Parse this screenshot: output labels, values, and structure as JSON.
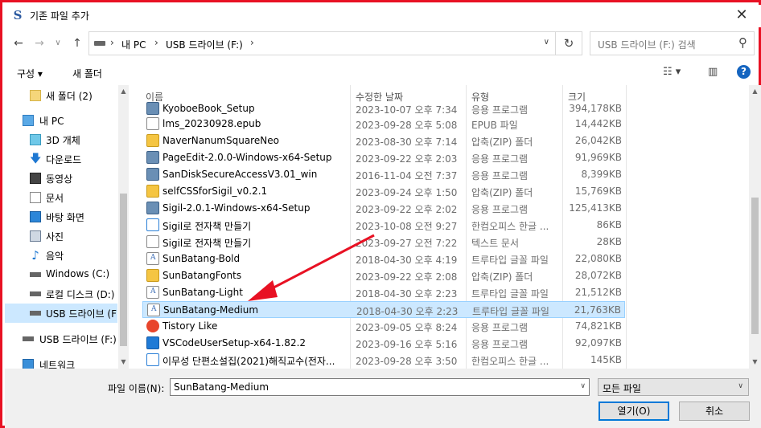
{
  "window": {
    "title": "기존 파일 추가",
    "app_icon_glyph": "S",
    "close_glyph": "✕"
  },
  "nav": {
    "back_glyph": "←",
    "forward_glyph": "→",
    "recent_glyph": "∨",
    "up_glyph": "↑",
    "address": {
      "crumbs": [
        "내 PC",
        "USB 드라이브 (F:)"
      ],
      "sep": "›",
      "dropdown_glyph": "∨",
      "refresh_glyph": "↻"
    },
    "search": {
      "placeholder": "USB 드라이브 (F:) 검색",
      "icon_glyph": "⚲"
    }
  },
  "toolbar": {
    "organize_label": "구성 ▾",
    "new_folder_label": "새 폴더",
    "view_glyph": "☷ ▾",
    "pane_glyph": "▥",
    "help_glyph": "?"
  },
  "sidebar": {
    "items": [
      {
        "label": "새 폴더 (2)",
        "icon": "folder-icon"
      },
      {
        "label": "내 PC",
        "icon": "pc-icon"
      },
      {
        "label": "3D 개체",
        "icon": "cube-icon"
      },
      {
        "label": "다운로드",
        "icon": "download-icon"
      },
      {
        "label": "동영상",
        "icon": "video-icon"
      },
      {
        "label": "문서",
        "icon": "document-icon"
      },
      {
        "label": "바탕 화면",
        "icon": "desktop-icon"
      },
      {
        "label": "사진",
        "icon": "picture-icon"
      },
      {
        "label": "음악",
        "icon": "music-icon"
      },
      {
        "label": "Windows (C:)",
        "icon": "drive-icon"
      },
      {
        "label": "로컬 디스크 (D:)",
        "icon": "drive-icon"
      },
      {
        "label": "USB 드라이브 (F",
        "icon": "usb-drive-icon"
      },
      {
        "label": "USB 드라이브 (F:)",
        "icon": "usb-drive-icon"
      },
      {
        "label": "네트워크",
        "icon": "network-icon"
      }
    ],
    "up_glyph": "▲",
    "down_glyph": "▼"
  },
  "files": {
    "columns": {
      "name": "이름",
      "date": "수정한 날짜",
      "type": "유형",
      "size": "크기"
    },
    "rows": [
      {
        "name": "KyoboeBook_Setup",
        "date": "2023-10-07 오후 7:34",
        "type": "응용 프로그램",
        "size": "394,178KB",
        "icon": "exe"
      },
      {
        "name": "lms_20230928.epub",
        "date": "2023-09-28 오후 5:08",
        "type": "EPUB 파일",
        "size": "14,442KB",
        "icon": "doc"
      },
      {
        "name": "NaverNanumSquareNeo",
        "date": "2023-08-30 오후 7:14",
        "type": "압축(ZIP) 폴더",
        "size": "26,042KB",
        "icon": "zip"
      },
      {
        "name": "PageEdit-2.0.0-Windows-x64-Setup",
        "date": "2023-09-22 오후 2:03",
        "type": "응용 프로그램",
        "size": "91,969KB",
        "icon": "exe"
      },
      {
        "name": "SanDiskSecureAccessV3.01_win",
        "date": "2016-11-04 오전 7:37",
        "type": "응용 프로그램",
        "size": "8,399KB",
        "icon": "exe"
      },
      {
        "name": "selfCSSforSigil_v0.2.1",
        "date": "2023-09-24 오후 1:50",
        "type": "압축(ZIP) 폴더",
        "size": "15,769KB",
        "icon": "zip"
      },
      {
        "name": "Sigil-2.0.1-Windows-x64-Setup",
        "date": "2023-09-22 오후 2:02",
        "type": "응용 프로그램",
        "size": "125,413KB",
        "icon": "exe"
      },
      {
        "name": "Sigil로 전자책 만들기",
        "date": "2023-10-08 오전 9:27",
        "type": "한컴오피스 한글 ...",
        "size": "86KB",
        "icon": "hwp"
      },
      {
        "name": "Sigil로 전자책 만들기",
        "date": "2023-09-27 오전 7:22",
        "type": "텍스트 문서",
        "size": "28KB",
        "icon": "doc"
      },
      {
        "name": "SunBatang-Bold",
        "date": "2018-04-30 오후 4:19",
        "type": "트루타입 글꼴 파일",
        "size": "22,080KB",
        "icon": "font"
      },
      {
        "name": "SunBatangFonts",
        "date": "2023-09-22 오후 2:08",
        "type": "압축(ZIP) 폴더",
        "size": "28,072KB",
        "icon": "zip"
      },
      {
        "name": "SunBatang-Light",
        "date": "2018-04-30 오후 2:23",
        "type": "트루타입 글꼴 파일",
        "size": "21,512KB",
        "icon": "font"
      },
      {
        "name": "SunBatang-Medium",
        "date": "2018-04-30 오후 2:23",
        "type": "트루타입 글꼴 파일",
        "size": "21,763KB",
        "icon": "font",
        "selected": true
      },
      {
        "name": "Tistory Like",
        "date": "2023-09-05 오후 8:24",
        "type": "응용 프로그램",
        "size": "74,821KB",
        "icon": "tistory"
      },
      {
        "name": "VSCodeUserSetup-x64-1.82.2",
        "date": "2023-09-16 오후 5:16",
        "type": "응용 프로그램",
        "size": "92,097KB",
        "icon": "vs"
      },
      {
        "name": "이무성 단편소설집(2021)해직교수(전자...",
        "date": "2023-09-28 오후 3:50",
        "type": "한컴오피스 한글 ...",
        "size": "145KB",
        "icon": "hwp"
      }
    ]
  },
  "bottom": {
    "filename_label": "파일 이름(N):",
    "filename_value": "SunBatang-Medium",
    "filetype_value": "모든 파일",
    "open_label": "열기(O)",
    "cancel_label": "취소",
    "dropdown_glyph": "∨"
  },
  "annotation": {
    "arrow_color": "#e81123"
  }
}
